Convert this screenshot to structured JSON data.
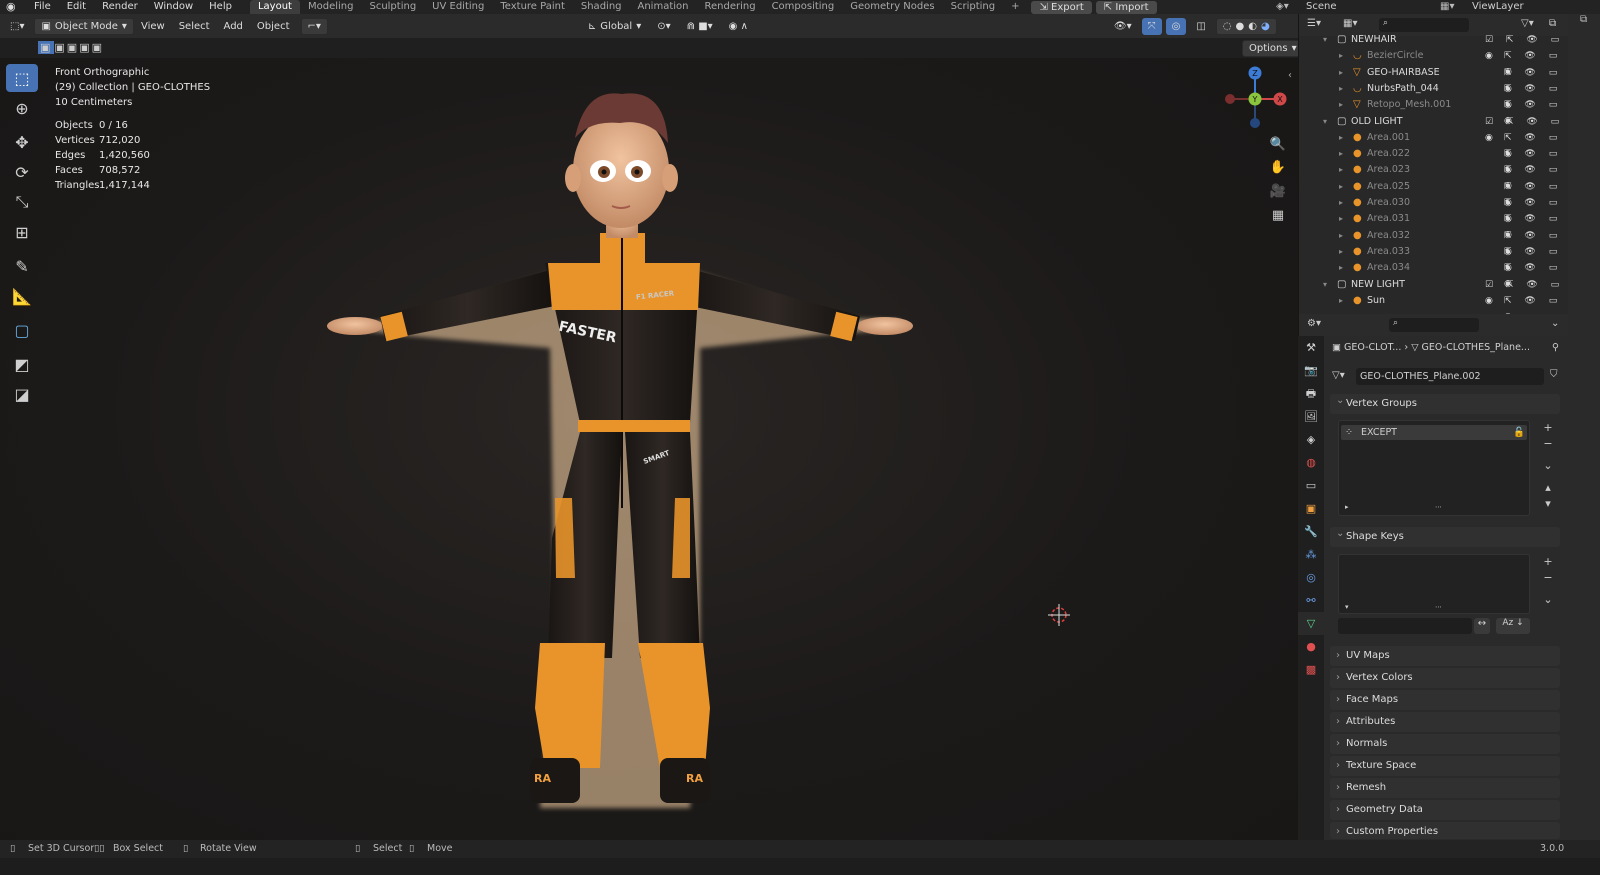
{
  "app": {
    "logo": "blender-logo-icon"
  },
  "menu": [
    "File",
    "Edit",
    "Render",
    "Window",
    "Help"
  ],
  "workspaces": [
    {
      "label": "Layout",
      "active": true
    },
    {
      "label": "Modeling"
    },
    {
      "label": "Sculpting"
    },
    {
      "label": "UV Editing"
    },
    {
      "label": "Texture Paint"
    },
    {
      "label": "Shading"
    },
    {
      "label": "Animation"
    },
    {
      "label": "Rendering"
    },
    {
      "label": "Compositing"
    },
    {
      "label": "Geometry Nodes"
    },
    {
      "label": "Scripting"
    }
  ],
  "topbar": {
    "add_tab": "+",
    "export": "Export",
    "import": "Import",
    "scene": "Scene",
    "view_layer": "ViewLayer"
  },
  "viewport_header": {
    "mode": "Object Mode",
    "view": "View",
    "select": "Select",
    "add": "Add",
    "object": "Object",
    "orientation": "Global",
    "options": "Options"
  },
  "overlay": {
    "view_name": "Front Orthographic",
    "collection": "(29) Collection | GEO-CLOTHES",
    "scale": "10 Centimeters",
    "stats": [
      {
        "label": "Objects",
        "value": "0 / 16"
      },
      {
        "label": "Vertices",
        "value": "712,020"
      },
      {
        "label": "Edges",
        "value": "1,420,560"
      },
      {
        "label": "Faces",
        "value": "708,572"
      },
      {
        "label": "Triangles",
        "value": "1,417,144"
      }
    ]
  },
  "character": {
    "chest_text": "FASTER",
    "badge_text": "F1 RACER",
    "hip_text": "SMART",
    "boot_text": "RA"
  },
  "gizmo": {
    "z": "Z",
    "y": "Y",
    "x": "X"
  },
  "outliner": {
    "rows": [
      {
        "name": "NEWHAIR",
        "kind": "collection"
      },
      {
        "name": "BezierCircle",
        "kind": "curve"
      },
      {
        "name": "GEO-HAIRBASE",
        "kind": "mesh"
      },
      {
        "name": "NurbsPath_044",
        "kind": "curve"
      },
      {
        "name": "Retopo_Mesh.001",
        "kind": "mesh"
      },
      {
        "name": "OLD LIGHT",
        "kind": "collection"
      },
      {
        "name": "Area.001",
        "kind": "light"
      },
      {
        "name": "Area.022",
        "kind": "light"
      },
      {
        "name": "Area.023",
        "kind": "light"
      },
      {
        "name": "Area.025",
        "kind": "light"
      },
      {
        "name": "Area.030",
        "kind": "light"
      },
      {
        "name": "Area.031",
        "kind": "light"
      },
      {
        "name": "Area.032",
        "kind": "light"
      },
      {
        "name": "Area.033",
        "kind": "light"
      },
      {
        "name": "Area.034",
        "kind": "light"
      },
      {
        "name": "NEW LIGHT",
        "kind": "collection"
      },
      {
        "name": "Sun",
        "kind": "sun"
      }
    ]
  },
  "properties": {
    "breadcrumb_object": "GEO-CLOT...",
    "breadcrumb_mesh": "GEO-CLOTHES_Plane...",
    "mesh_name": "GEO-CLOTHES_Plane.002",
    "vertex_groups": {
      "title": "Vertex Groups",
      "items": [
        "EXCEPT"
      ]
    },
    "shape_keys": {
      "title": "Shape Keys"
    },
    "panels": [
      "UV Maps",
      "Vertex Colors",
      "Face Maps",
      "Attributes",
      "Normals",
      "Texture Space",
      "Remesh",
      "Geometry Data",
      "Custom Properties"
    ]
  },
  "statusbar": {
    "set_cursor": "Set 3D Cursor",
    "box_select": "Box Select",
    "rotate_view": "Rotate View",
    "select": "Select",
    "move": "Move",
    "version": "3.0.0"
  }
}
